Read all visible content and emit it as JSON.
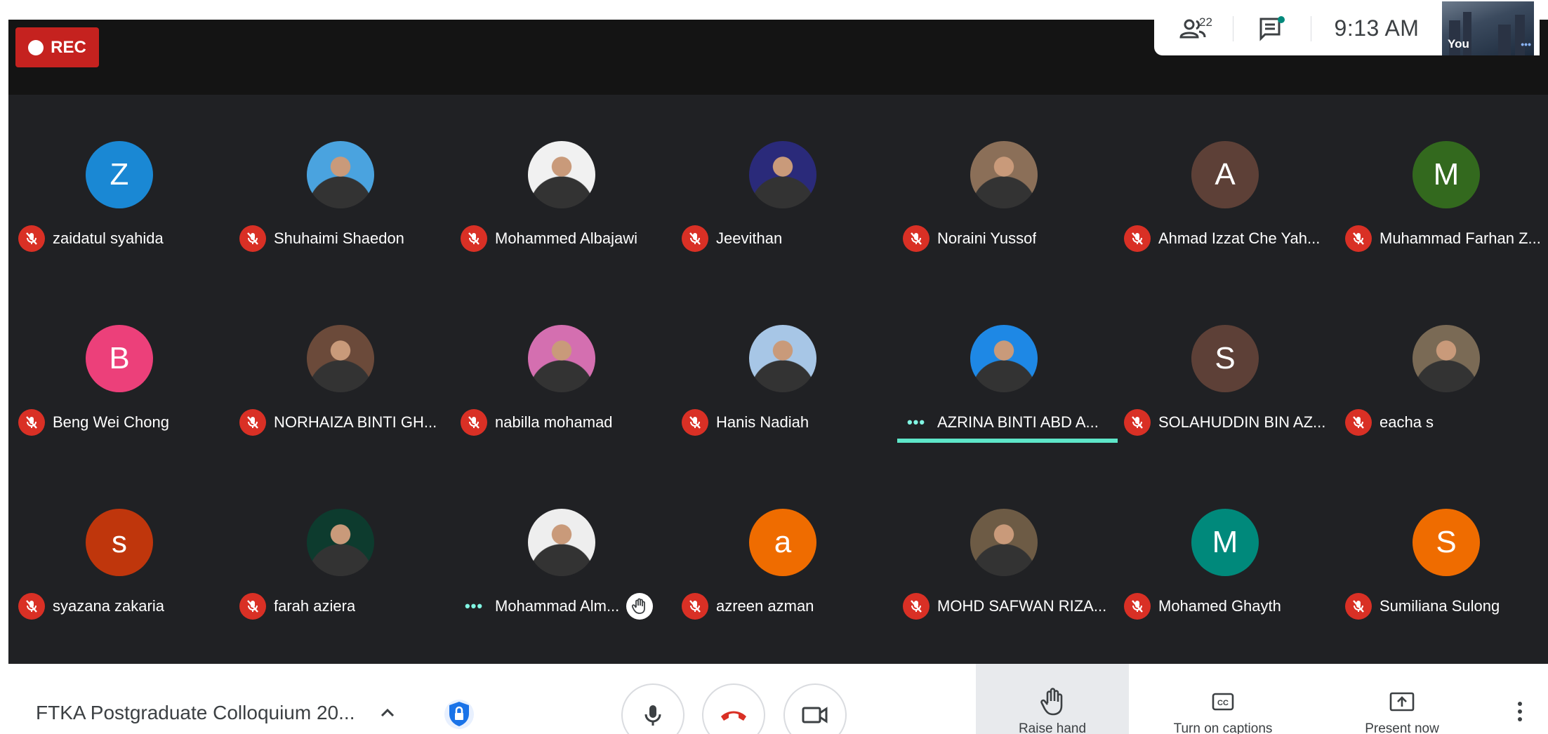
{
  "recording": {
    "label": "REC"
  },
  "info_panel": {
    "participant_count": "22",
    "people_icon": "people-icon",
    "chat_icon": "chat-icon",
    "time": "9:13 AM",
    "self_label": "You"
  },
  "participants": [
    {
      "name": "zaidatul syahida",
      "initial": "Z",
      "color": "#1a88d4",
      "photo": false,
      "status": "muted"
    },
    {
      "name": "Shuhaimi Shaedon",
      "initial": "",
      "color": "#4aa3df",
      "photo": true,
      "status": "muted"
    },
    {
      "name": "Mohammed Albajawi",
      "initial": "",
      "color": "#f1f1f1",
      "photo": true,
      "status": "muted"
    },
    {
      "name": "Jeevithan",
      "initial": "",
      "color": "#2a2a7a",
      "photo": true,
      "status": "muted"
    },
    {
      "name": "Noraini Yussof",
      "initial": "",
      "color": "#8b6f58",
      "photo": true,
      "status": "muted"
    },
    {
      "name": "Ahmad Izzat Che Yah...",
      "initial": "A",
      "color": "#5d4037",
      "photo": false,
      "status": "muted"
    },
    {
      "name": "Muhammad Farhan Z...",
      "initial": "M",
      "color": "#33691e",
      "photo": false,
      "status": "muted"
    },
    {
      "name": "Beng Wei Chong",
      "initial": "B",
      "color": "#ec407a",
      "photo": false,
      "status": "muted"
    },
    {
      "name": "NORHAIZA BINTI GH...",
      "initial": "",
      "color": "#6b4a3a",
      "photo": true,
      "status": "muted"
    },
    {
      "name": "nabilla mohamad",
      "initial": "",
      "color": "#d46fb0",
      "photo": true,
      "status": "muted"
    },
    {
      "name": "Hanis Nadiah",
      "initial": "",
      "color": "#a7c6e6",
      "photo": true,
      "status": "muted"
    },
    {
      "name": "AZRINA BINTI ABD A...",
      "initial": "",
      "color": "#1e88e5",
      "photo": true,
      "status": "speaking",
      "active": true
    },
    {
      "name": "SOLAHUDDIN BIN AZ...",
      "initial": "S",
      "color": "#5d4037",
      "photo": false,
      "status": "muted"
    },
    {
      "name": "eacha s",
      "initial": "",
      "color": "#7a6a55",
      "photo": true,
      "status": "muted"
    },
    {
      "name": "syazana zakaria",
      "initial": "s",
      "color": "#bf360c",
      "photo": false,
      "status": "muted"
    },
    {
      "name": "farah aziera",
      "initial": "",
      "color": "#0d3b2e",
      "photo": true,
      "status": "muted"
    },
    {
      "name": "Mohammad Alm...",
      "initial": "",
      "color": "#eeeeee",
      "photo": true,
      "status": "speaking",
      "hand_raised": true
    },
    {
      "name": "azreen azman",
      "initial": "a",
      "color": "#ef6c00",
      "photo": false,
      "status": "muted"
    },
    {
      "name": "MOHD SAFWAN RIZA...",
      "initial": "",
      "color": "#6d5b45",
      "photo": true,
      "status": "muted"
    },
    {
      "name": "Mohamed Ghayth",
      "initial": "M",
      "color": "#00897b",
      "photo": false,
      "status": "muted"
    },
    {
      "name": "Sumiliana Sulong",
      "initial": "S",
      "color": "#ef6c00",
      "photo": false,
      "status": "muted"
    }
  ],
  "bottom_bar": {
    "meeting_title": "FTKA Postgraduate Colloquium 20...",
    "raise_hand": "Raise hand",
    "captions": "Turn on captions",
    "present": "Present now"
  }
}
